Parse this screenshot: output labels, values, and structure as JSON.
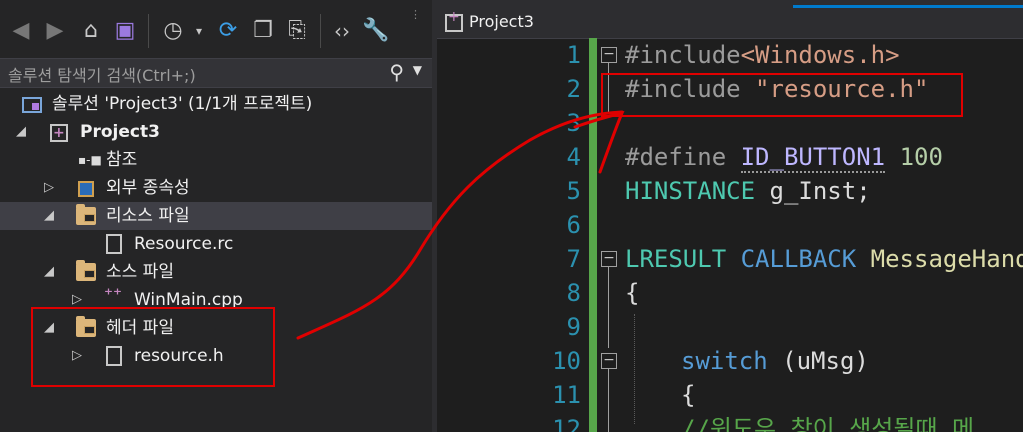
{
  "solution_explorer": {
    "search_placeholder": "솔루션 탐색기 검색(Ctrl+;)",
    "toolbar_icons": [
      "back-icon",
      "forward-icon",
      "home-icon",
      "vs-solution-icon",
      "history-icon",
      "dropdown-icon",
      "sync-icon",
      "collapse-all-icon",
      "show-all-files-icon",
      "code-view-icon",
      "properties-wrench-icon"
    ],
    "tree": [
      {
        "label": "솔루션 'Project3' (1/1개 프로젝트)",
        "icon": "solution-icon",
        "expanded": true
      },
      {
        "label": "Project3",
        "icon": "vs-project-icon",
        "expanded": true,
        "bold": true
      },
      {
        "label": "참조",
        "icon": "references-icon"
      },
      {
        "label": "외부 종속성",
        "icon": "external-deps-icon",
        "expanded": false
      },
      {
        "label": "리소스 파일",
        "icon": "folder-icon",
        "expanded": true,
        "selected": true
      },
      {
        "label": "Resource.rc",
        "icon": "rc-file-icon"
      },
      {
        "label": "소스 파일",
        "icon": "folder-icon",
        "expanded": true
      },
      {
        "label": "WinMain.cpp",
        "icon": "cpp-file-icon",
        "expanded": false
      },
      {
        "label": "헤더 파일",
        "icon": "folder-icon",
        "expanded": true
      },
      {
        "label": "resource.h",
        "icon": "h-file-icon",
        "expanded": false
      }
    ]
  },
  "editor": {
    "nav_title": "Project3",
    "line_numbers": [
      "1",
      "2",
      "3",
      "4",
      "5",
      "6",
      "7",
      "8",
      "9",
      "10",
      "11",
      "12"
    ],
    "lines": [
      {
        "prefix": "#include",
        "rest": "<Windows.h>"
      },
      {
        "prefix": "#include",
        "rest": " \"resource.h\""
      },
      {
        "prefix": "",
        "rest": ""
      },
      {
        "prefix": "#define",
        "macro": "ID_BUTTON1",
        "value": "100"
      },
      {
        "type": "HINSTANCE",
        "rest": " g_Inst;"
      },
      {
        "prefix": "",
        "rest": ""
      },
      {
        "type": "LRESULT",
        "kw": "CALLBACK",
        "fn": "MessageHand"
      },
      {
        "rest": "{"
      },
      {
        "rest": ""
      },
      {
        "kw": "switch",
        "rest": " (uMsg)"
      },
      {
        "rest": "{"
      },
      {
        "comment": "//윈도우 창이 생성될때 메"
      }
    ]
  },
  "colors": {
    "annotation_red": "#e00000",
    "accent": "#007acc",
    "change_bar": "#57a64a"
  }
}
